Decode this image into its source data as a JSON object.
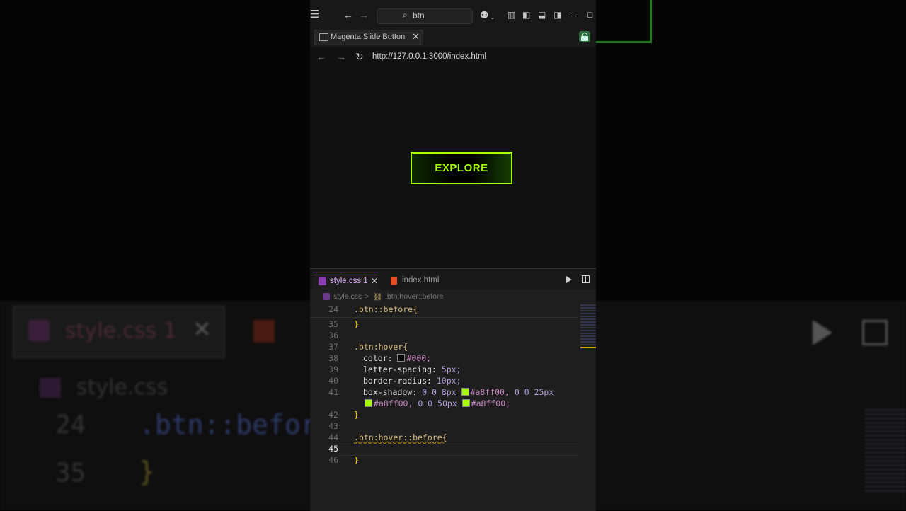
{
  "window": {
    "search_text": "btn"
  },
  "browser": {
    "tab_title": "Magenta Slide Button",
    "url": "http://127.0.0.1:3000/index.html"
  },
  "preview": {
    "button_label": "EXPLORE"
  },
  "editor": {
    "tabs": [
      {
        "label": "style.css 1",
        "active": true
      },
      {
        "label": "index.html",
        "active": false
      }
    ],
    "breadcrumb": {
      "file": "style.css",
      "separator": ">",
      "symbol": ".btn:hover::before"
    },
    "lines": [
      {
        "num": "24",
        "text": ".btn::before{"
      },
      {
        "num": "35",
        "text": "}"
      },
      {
        "num": "36",
        "text": ""
      },
      {
        "num": "37",
        "text": ".btn:hover{"
      },
      {
        "num": "38",
        "prop": "color:",
        "value": "#000;",
        "swatch": "#000000"
      },
      {
        "num": "39",
        "prop": "letter-spacing:",
        "value": "5px;"
      },
      {
        "num": "40",
        "prop": "border-radius:",
        "value": "10px;"
      },
      {
        "num": "41",
        "prop": "box-shadow:",
        "value_a": "0 0 8px",
        "color_a": "#a8ff00,",
        "value_b": "0 0 25px"
      },
      {
        "num": "",
        "color_b": "#a8ff00,",
        "value_c": "0 0 50px",
        "color_c": "#a8ff00;"
      },
      {
        "num": "42",
        "text": "}"
      },
      {
        "num": "43",
        "text": ""
      },
      {
        "num": "44",
        "text": ".btn:hover::before{"
      },
      {
        "num": "45",
        "text": ""
      },
      {
        "num": "46",
        "text": "}"
      }
    ]
  },
  "colors": {
    "accent_green": "#a8ff00",
    "css_icon": "#8a3fb0",
    "html_icon": "#e44d26",
    "lock_button": "#2e6b3e"
  }
}
